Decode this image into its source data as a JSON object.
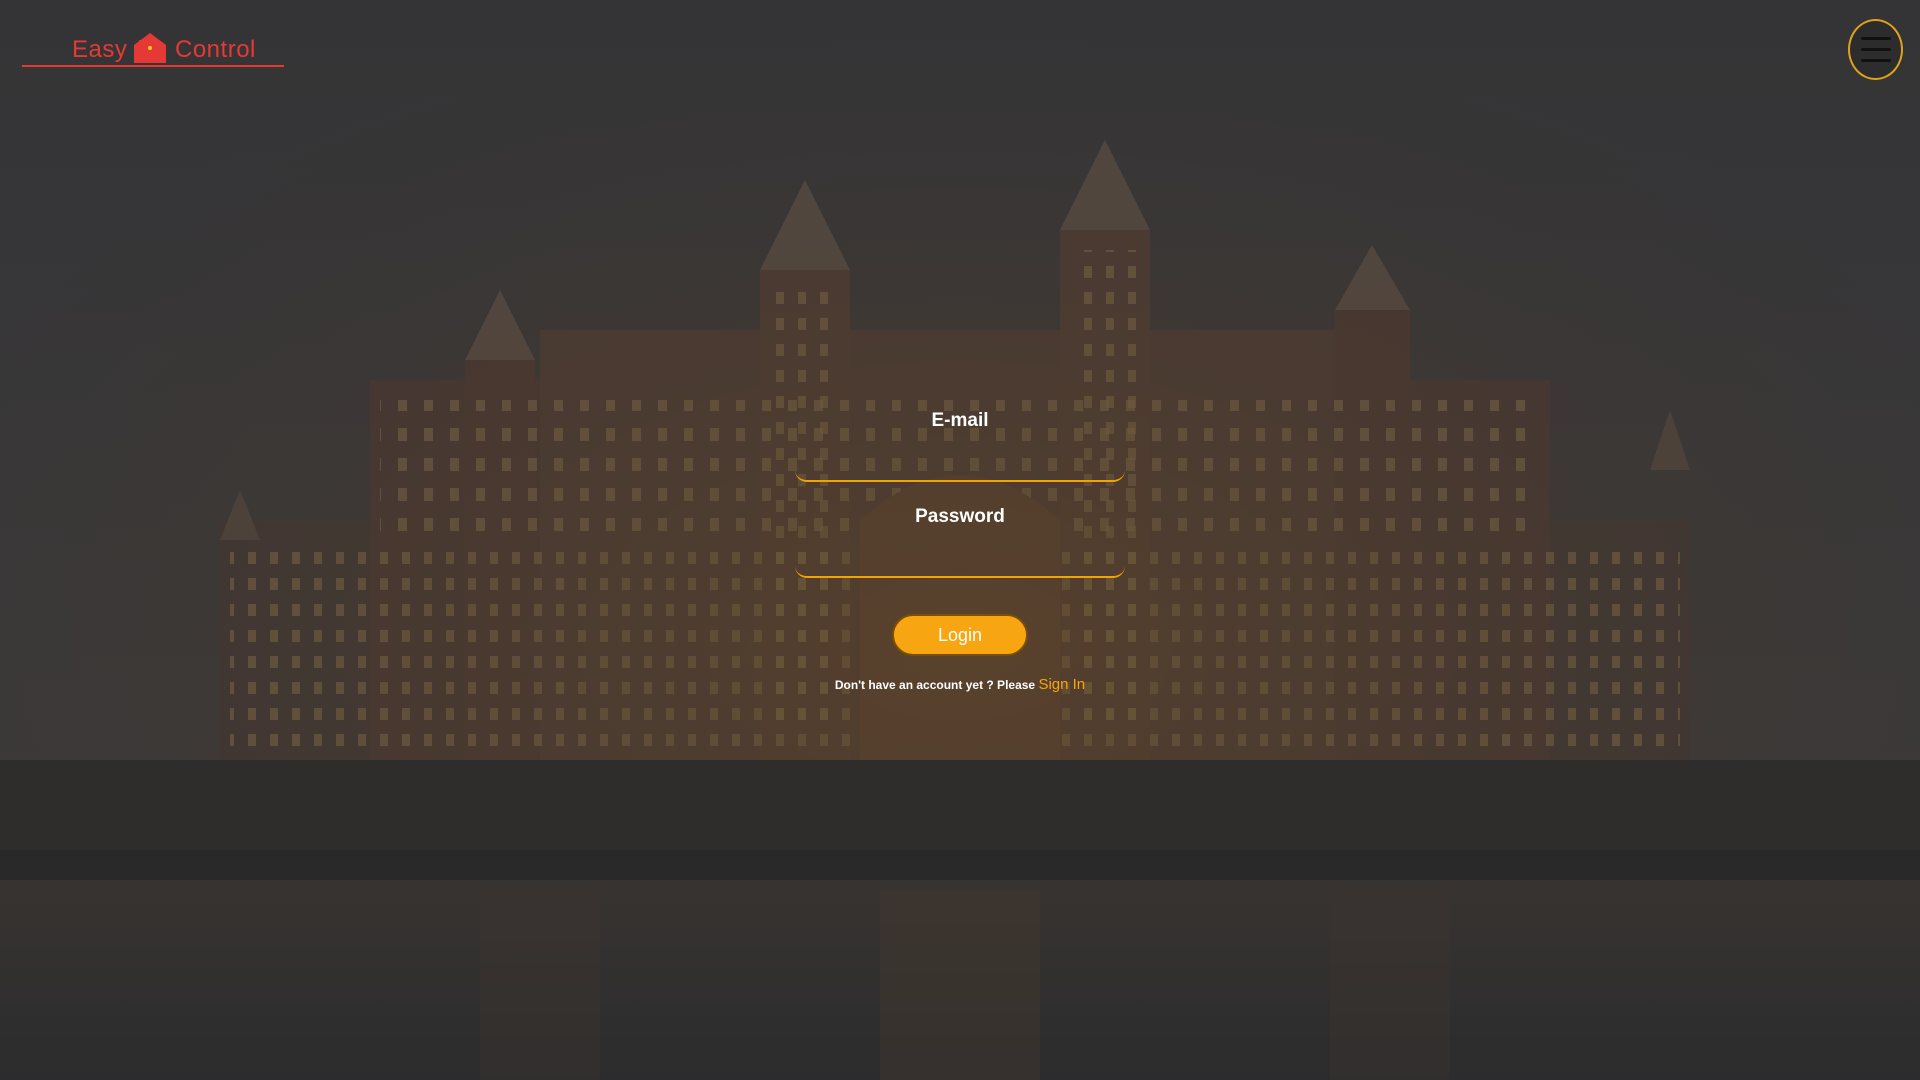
{
  "logo": {
    "word1": "Easy",
    "word2": "Control"
  },
  "menu": {
    "icon": "hamburger-icon"
  },
  "form": {
    "email_label": "E-mail",
    "email_value": "",
    "password_label": "Password",
    "password_value": "",
    "login_label": "Login",
    "signup_text": "Don't have an account yet ? Please",
    "signup_link": "Sign In"
  },
  "colors": {
    "accent": "#f7a510",
    "logo": "#e53935",
    "overlay": "#3a3a3c"
  }
}
